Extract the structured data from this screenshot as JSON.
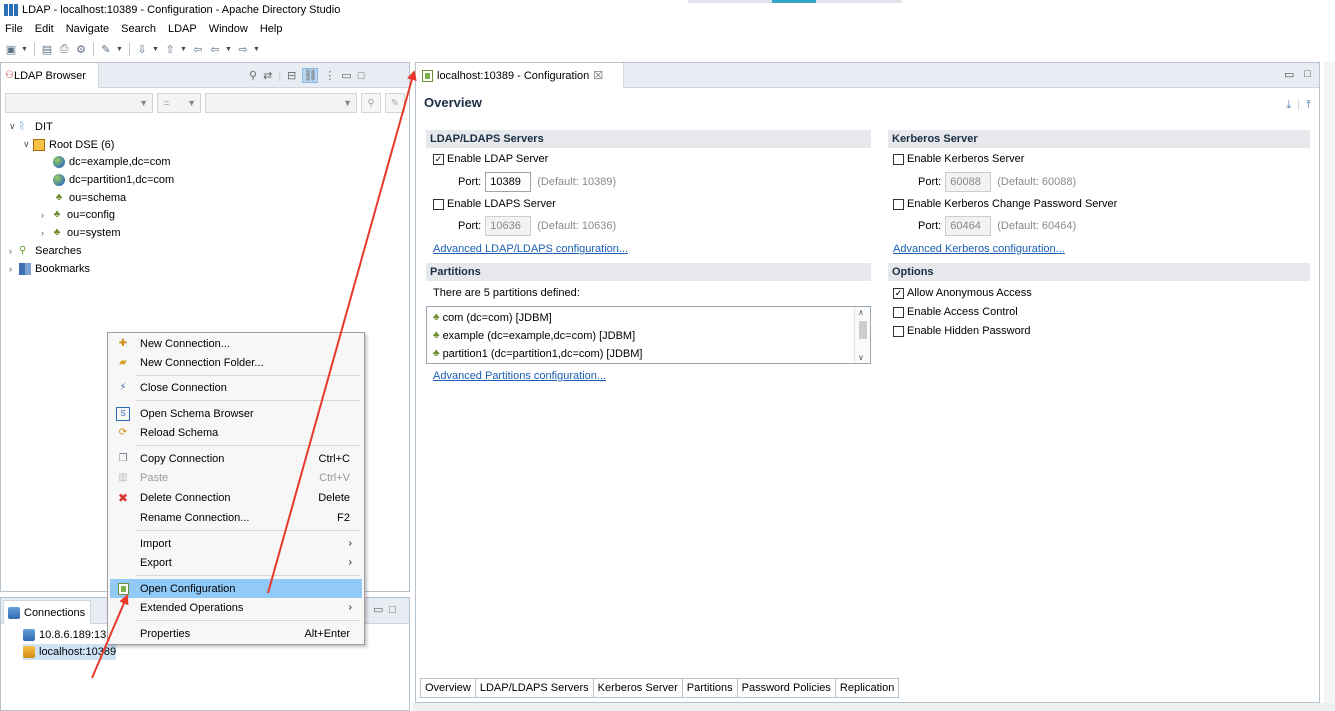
{
  "window": {
    "title": "LDAP - localhost:10389 - Configuration - Apache Directory Studio"
  },
  "menubar": [
    "File",
    "Edit",
    "Navigate",
    "Search",
    "LDAP",
    "Window",
    "Help"
  ],
  "browser": {
    "tab_label": "LDAP Browser",
    "filter_op": "=",
    "tree": {
      "dit": "DIT",
      "root_dse": "Root DSE (6)",
      "entries": [
        "dc=example,dc=com",
        "dc=partition1,dc=com",
        "ou=schema",
        "ou=config",
        "ou=system"
      ],
      "searches": "Searches",
      "bookmarks": "Bookmarks"
    }
  },
  "connections": {
    "tab_label": "Connections",
    "items": [
      "10.8.6.189:13",
      "localhost:10389"
    ]
  },
  "context_menu": {
    "items": [
      {
        "label": "New Connection...",
        "shortcut": ""
      },
      {
        "label": "New Connection Folder...",
        "shortcut": ""
      },
      {
        "label": "Close Connection",
        "shortcut": ""
      },
      {
        "label": "Open Schema Browser",
        "shortcut": ""
      },
      {
        "label": "Reload Schema",
        "shortcut": ""
      },
      {
        "label": "Copy Connection",
        "shortcut": "Ctrl+C"
      },
      {
        "label": "Paste",
        "shortcut": "Ctrl+V"
      },
      {
        "label": "Delete Connection",
        "shortcut": "Delete"
      },
      {
        "label": "Rename Connection...",
        "shortcut": "F2"
      },
      {
        "label": "Import",
        "shortcut": ""
      },
      {
        "label": "Export",
        "shortcut": ""
      },
      {
        "label": "Open Configuration",
        "shortcut": ""
      },
      {
        "label": "Extended Operations",
        "shortcut": ""
      },
      {
        "label": "Properties",
        "shortcut": "Alt+Enter"
      }
    ]
  },
  "editor": {
    "tab_label": "localhost:10389 - Configuration",
    "tab_close": "☒",
    "overview_title": "Overview",
    "ldap_section": {
      "title": "LDAP/LDAPS Servers",
      "enable_ldap": "Enable LDAP Server",
      "ldap_port_label": "Port:",
      "ldap_port": "10389",
      "ldap_default": "(Default: 10389)",
      "enable_ldaps": "Enable LDAPS Server",
      "ldaps_port_label": "Port:",
      "ldaps_port": "10636",
      "ldaps_default": "(Default: 10636)",
      "advanced_link": "Advanced LDAP/LDAPS configuration..."
    },
    "kerberos_section": {
      "title": "Kerberos Server",
      "enable_kerberos": "Enable Kerberos Server",
      "kerberos_port_label": "Port:",
      "kerberos_port": "60088",
      "kerberos_default": "(Default: 60088)",
      "enable_change_pw": "Enable Kerberos Change Password Server",
      "change_pw_port_label": "Port:",
      "change_pw_port": "60464",
      "change_pw_default": "(Default: 60464)",
      "advanced_link": "Advanced Kerberos configuration..."
    },
    "partitions_section": {
      "title": "Partitions",
      "summary": "There are 5 partitions defined:",
      "items": [
        "com (dc=com) [JDBM]",
        "example (dc=example,dc=com) [JDBM]",
        "partition1 (dc=partition1,dc=com) [JDBM]"
      ],
      "advanced_link": "Advanced Partitions configuration..."
    },
    "options_section": {
      "title": "Options",
      "allow_anonymous": "Allow Anonymous Access",
      "enable_access_control": "Enable Access Control",
      "enable_hidden_password": "Enable Hidden Password"
    },
    "page_tabs": [
      "Overview",
      "LDAP/LDAPS Servers",
      "Kerberos Server",
      "Partitions",
      "Password Policies",
      "Replication"
    ]
  },
  "colors": {
    "selection": "#91c9f7",
    "link": "#1a5fb4",
    "annotation_arrow": "#e8392b"
  }
}
